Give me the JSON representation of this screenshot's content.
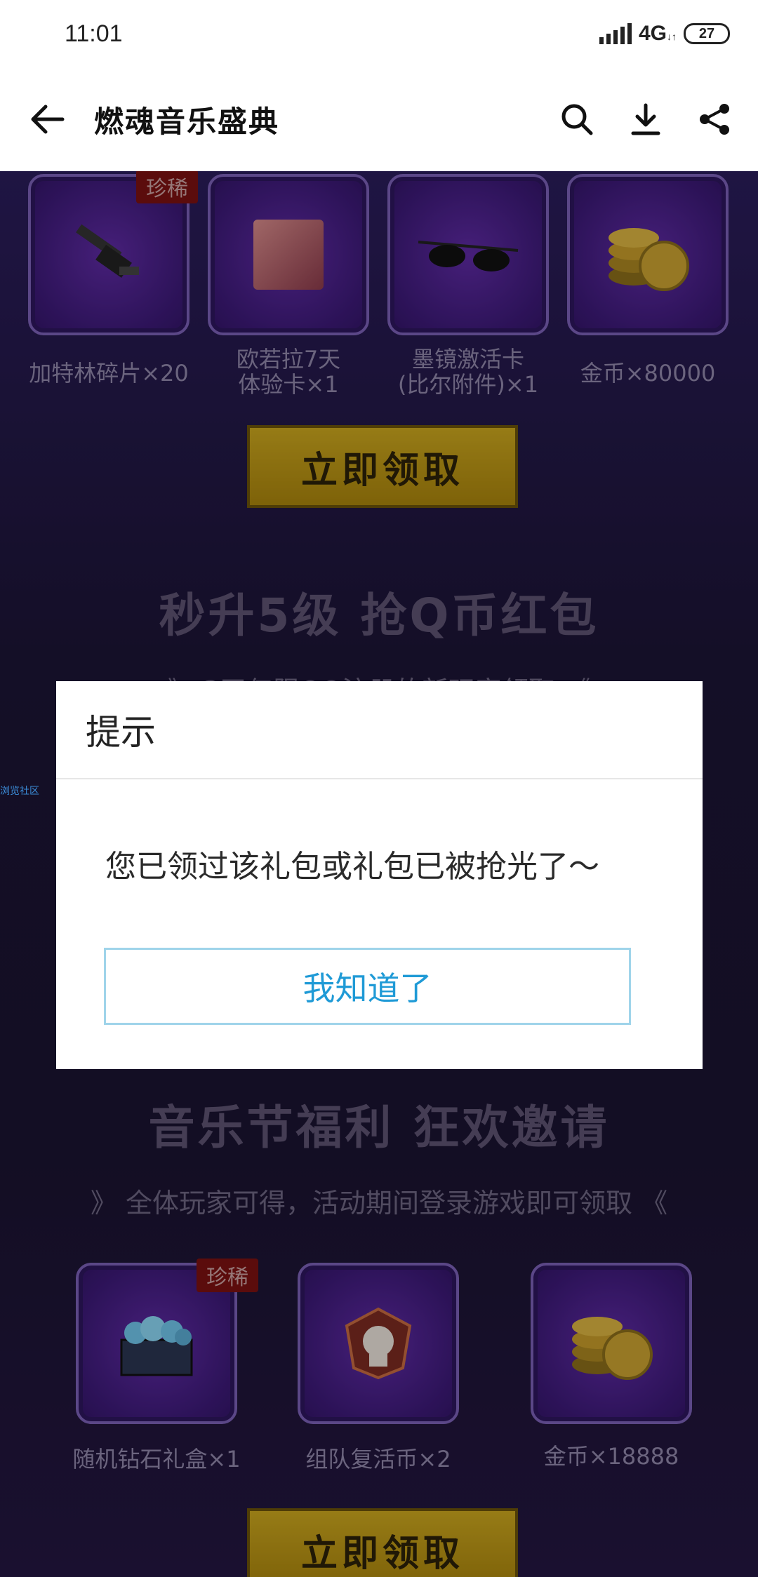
{
  "status_bar": {
    "time": "11:01",
    "network": "4G",
    "battery": "27"
  },
  "toolbar": {
    "title": "燃魂音乐盛典"
  },
  "rewards_top": {
    "rare_tag": "珍稀",
    "items": [
      {
        "label": "加特林碎片×20",
        "icon": "gatling-gun-icon"
      },
      {
        "label": "欧若拉7天\n体验卡×1",
        "icon": "character-portrait-icon"
      },
      {
        "label": "墨镜激活卡\n(比尔附件)×1",
        "icon": "sunglasses-icon"
      },
      {
        "label": "金币×80000",
        "icon": "gold-coins-icon"
      }
    ],
    "claim_label": "立即领取"
  },
  "section_level": {
    "title": "秒升5级 抢Q币红包",
    "subtitle": "》 3天仅限QQ注册的新玩家领取 《"
  },
  "side_link": "浏览社区",
  "section_music": {
    "title": "音乐节福利 狂欢邀请",
    "subtitle": "》 全体玩家可得，活动期间登录游戏即可领取 《"
  },
  "rewards_bottom": {
    "rare_tag": "珍稀",
    "items": [
      {
        "label": "随机钻石礼盒×1",
        "icon": "diamond-chest-icon"
      },
      {
        "label": "组队复活币×2",
        "icon": "revive-token-icon"
      },
      {
        "label": "金币×18888",
        "icon": "gold-coins-icon"
      }
    ],
    "claim_label": "立即领取"
  },
  "dialog": {
    "title": "提示",
    "message": "您已领过该礼包或礼包已被抢光了～",
    "button_label": "我知道了",
    "button_color": "#1f9ad6"
  }
}
